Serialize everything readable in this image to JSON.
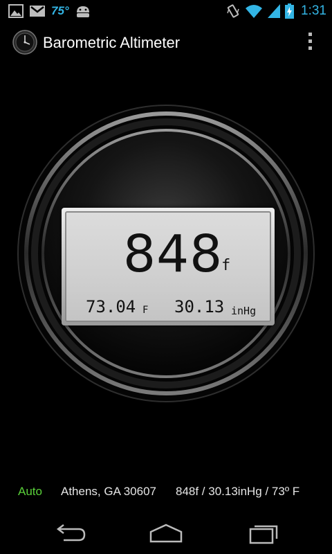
{
  "status_bar": {
    "temperature": "75°",
    "time": "1:31",
    "accent": "#33b5e5"
  },
  "action_bar": {
    "title": "Barometric Altimeter"
  },
  "display": {
    "altitude": "848",
    "altitude_unit": "f",
    "temperature": "73.04",
    "temperature_unit": "F",
    "pressure": "30.13",
    "pressure_unit": "inHg"
  },
  "info": {
    "mode": "Auto",
    "mode_color": "#5ad13a",
    "location": "Athens, GA 30607",
    "readings": "848f / 30.13inHg  /  73º F"
  },
  "nav": {
    "back": "back-icon",
    "home": "home-icon",
    "recents": "recents-icon"
  }
}
